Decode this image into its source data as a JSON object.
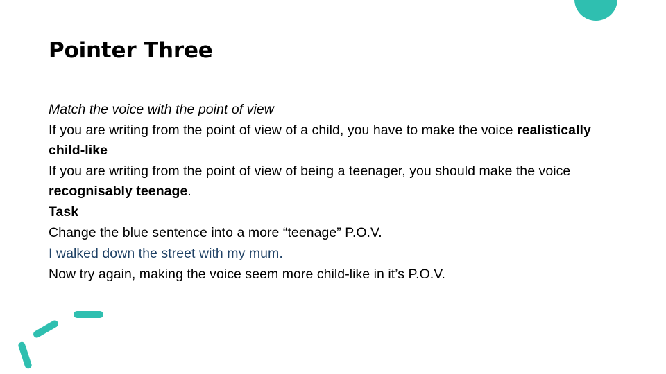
{
  "slide": {
    "title": "Pointer Three",
    "paragraphs": [
      {
        "id": "heading-match-voice",
        "style": "italic",
        "text": "Match the voice with the point of view"
      },
      {
        "id": "child-pov",
        "style": "normal",
        "prefix": "If you are writing from the point of view of a child, you have to make the voice ",
        "emphasis": "realistically child-like",
        "suffix": ""
      },
      {
        "id": "teenager-pov",
        "style": "normal",
        "prefix": "If you are writing from the point of view of being a teenager, you should make the voice ",
        "emphasis": "recognisably teenage",
        "suffix": "."
      },
      {
        "id": "task-label",
        "style": "bold",
        "text": "Task"
      },
      {
        "id": "task-instruction",
        "style": "normal",
        "text": "Change the blue sentence into a more “teenage” P.O.V."
      },
      {
        "id": "blue-sentence",
        "style": "blue",
        "text": "I walked down the street with my mum."
      },
      {
        "id": "task-followup",
        "style": "normal",
        "text": "Now try again, making the voice seem more child-like in it’s P.O.V."
      }
    ]
  },
  "decorations": {
    "accent_color": "#2FBFB0",
    "blue_text_color": "#1F4165",
    "title_color": "#000000",
    "background_color": "#FFFFFF",
    "shapes": [
      {
        "name": "semicircle",
        "position": "top-right"
      },
      {
        "name": "dash-horizontal",
        "position": "bottom-left"
      },
      {
        "name": "dash-diagonal",
        "position": "bottom-left"
      },
      {
        "name": "dash-steep",
        "position": "bottom-left"
      }
    ]
  }
}
